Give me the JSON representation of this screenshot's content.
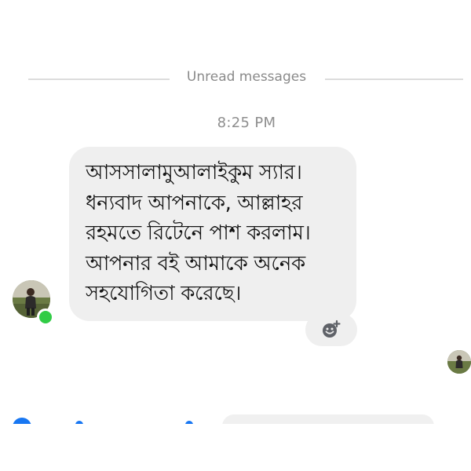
{
  "divider": {
    "label": "Unread messages"
  },
  "thread": {
    "timestamp": "8:25 PM",
    "message": {
      "text": "আসসালামুআলাইকুম স্যার।\nধন্যবাদ আপনাকে, আল্লাহর\nরহমতে রিটেনে পাশ করলাম।\nআপনার বই আমাকে অনেক\nসহযোগিতা করেছে।"
    }
  },
  "colors": {
    "bubble": "#efefef",
    "presence": "#31cc46",
    "accent": "#1877f2"
  },
  "icons": {
    "reaction": "add-reaction-icon",
    "presence": "online-status-icon"
  }
}
